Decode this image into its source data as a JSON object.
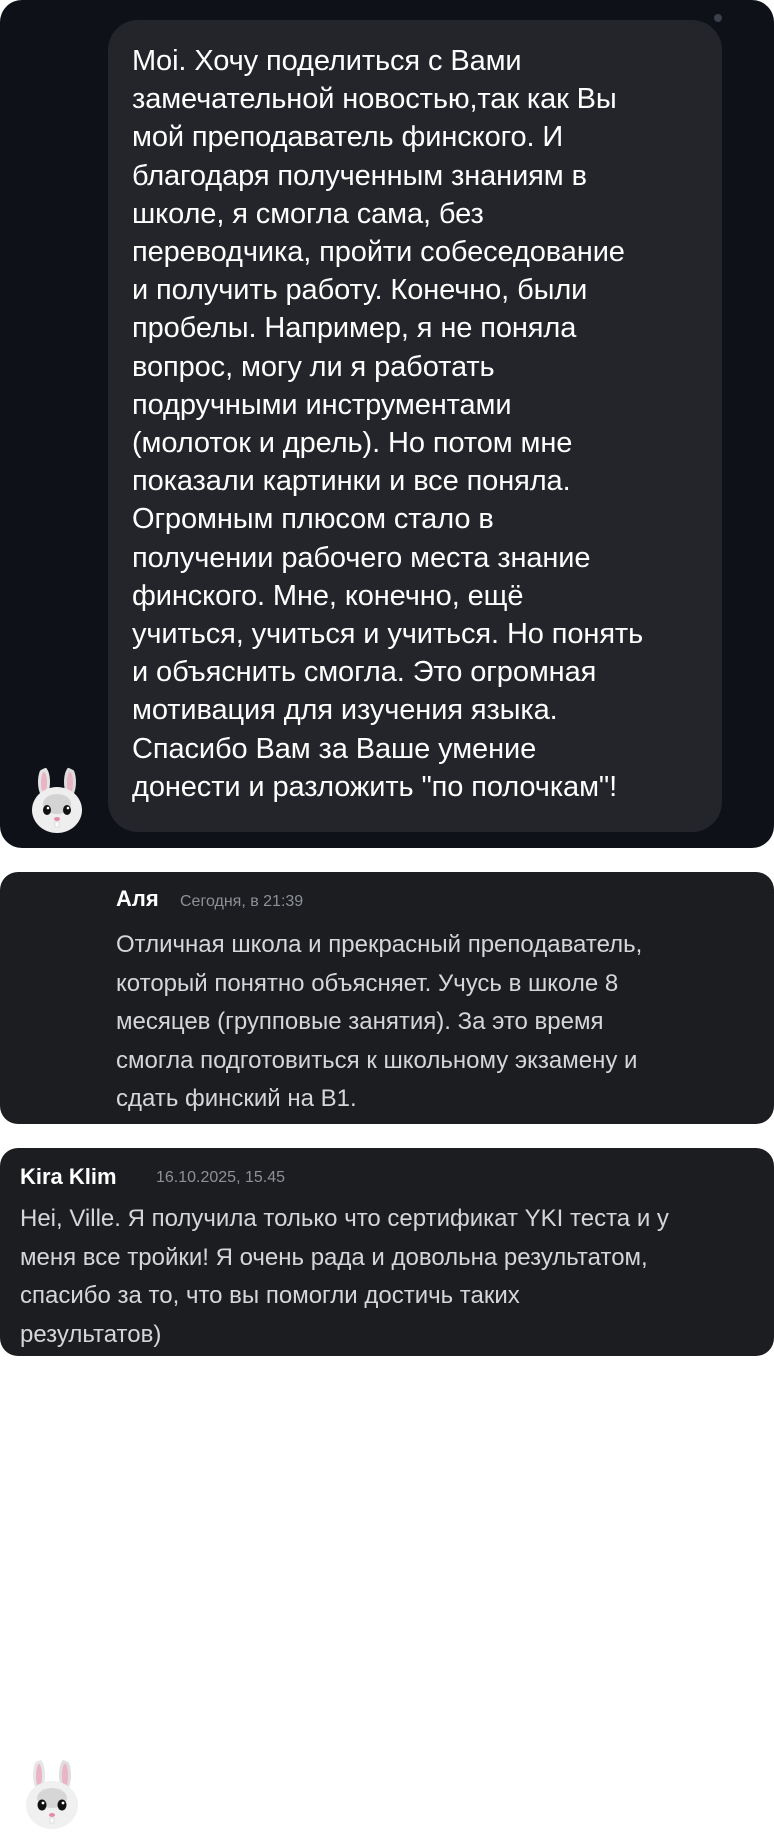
{
  "chat": {
    "message_lines": [
      "Moi. Хочу поделиться с Вами",
      "замечательной новостью,так как Вы",
      "мой преподаватель финского. И",
      "благодаря полученным знаниям в",
      "школе, я смогла сама, без",
      "переводчика, пройти собеседование",
      "и получить работу. Конечно, были",
      "пробелы. Например, я не поняла",
      "вопрос, могу ли я работать",
      "подручными инструментами",
      "(молоток и дрель). Но потом мне",
      "показали картинки и все поняла.",
      "Огромным плюсом стало в",
      "получении рабочего места знание",
      "финского. Мне, конечно, ещё",
      "учиться, учиться и учиться. Но понять",
      "и объяснить смогла. Это огромная",
      "мотивация для изучения языка.",
      "Спасибо Вам за Ваше умение",
      "донести и разложить \"по полочкам\"!"
    ],
    "avatar_icon": "bunny-avatar-icon"
  },
  "review1": {
    "author": "Аля",
    "timestamp": "Сегодня, в 21:39",
    "lines": [
      "Отличная школа и прекрасный преподаватель,",
      "который понятно объясняет. Учусь в школе 8",
      "месяцев (групповые занятия). За это время",
      "смогла подготовиться к школьному экзамену и",
      "сдать финский на В1."
    ],
    "avatar_icon": "bunny-avatar-icon"
  },
  "review2": {
    "author": "Kira Klim",
    "timestamp": "16.10.2025, 15.45",
    "lines": [
      "Hei, Ville. Я получила только что сертификат YKI теста и у",
      "меня все тройки! Я очень рада и довольна результатом,",
      "спасибо за то, что вы помогли достичь таких",
      "результатов)"
    ]
  },
  "colors": {
    "chat_background": "#0e1118",
    "bubble": "#23252b",
    "card": "#1c1d21",
    "text_primary": "#ffffff",
    "text_secondary": "#d5d6da",
    "timestamp": "#8d9097"
  }
}
